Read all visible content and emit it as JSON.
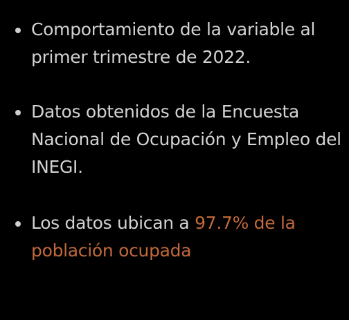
{
  "slide": {
    "bullets": [
      {
        "lines": [
          "Comportamiento de la variable al",
          "primer trimestre de 2022."
        ]
      },
      {
        "lines": [
          "Datos obtenidos de la Encuesta",
          "Nacional de Ocupación y Empleo del",
          "INEGI."
        ]
      },
      {
        "line1_prefix": "Los datos ubican a ",
        "line1_highlight": "97.7% de la",
        "line2_highlight": "población ocupada"
      }
    ]
  },
  "colors": {
    "background": "#000000",
    "text": "#d2d2d2",
    "bullet": "#cfcfcf",
    "highlight": "#c0693a"
  }
}
